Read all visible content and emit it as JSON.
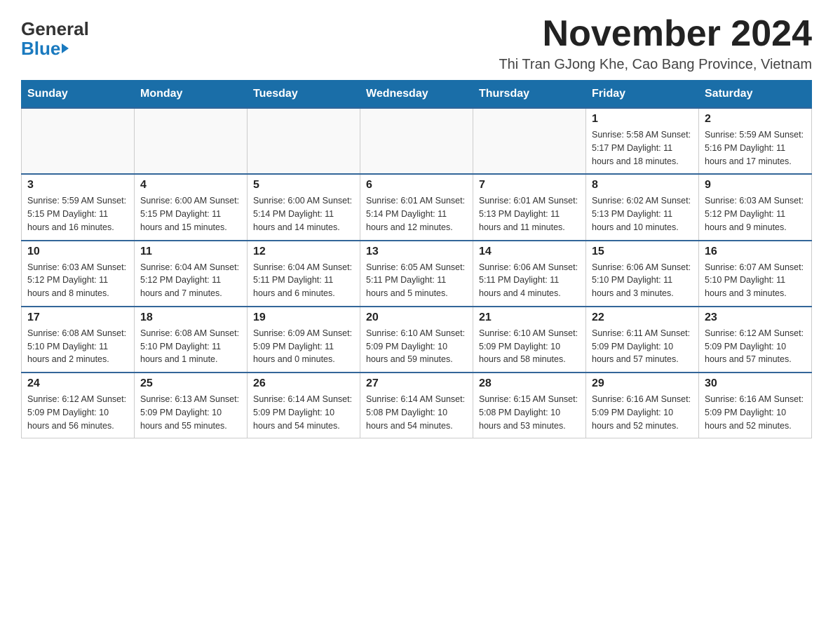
{
  "logo": {
    "general": "General",
    "blue": "Blue"
  },
  "title": "November 2024",
  "location": "Thi Tran GJong Khe, Cao Bang Province, Vietnam",
  "days_of_week": [
    "Sunday",
    "Monday",
    "Tuesday",
    "Wednesday",
    "Thursday",
    "Friday",
    "Saturday"
  ],
  "weeks": [
    [
      {
        "day": "",
        "info": ""
      },
      {
        "day": "",
        "info": ""
      },
      {
        "day": "",
        "info": ""
      },
      {
        "day": "",
        "info": ""
      },
      {
        "day": "",
        "info": ""
      },
      {
        "day": "1",
        "info": "Sunrise: 5:58 AM\nSunset: 5:17 PM\nDaylight: 11 hours and 18 minutes."
      },
      {
        "day": "2",
        "info": "Sunrise: 5:59 AM\nSunset: 5:16 PM\nDaylight: 11 hours and 17 minutes."
      }
    ],
    [
      {
        "day": "3",
        "info": "Sunrise: 5:59 AM\nSunset: 5:15 PM\nDaylight: 11 hours and 16 minutes."
      },
      {
        "day": "4",
        "info": "Sunrise: 6:00 AM\nSunset: 5:15 PM\nDaylight: 11 hours and 15 minutes."
      },
      {
        "day": "5",
        "info": "Sunrise: 6:00 AM\nSunset: 5:14 PM\nDaylight: 11 hours and 14 minutes."
      },
      {
        "day": "6",
        "info": "Sunrise: 6:01 AM\nSunset: 5:14 PM\nDaylight: 11 hours and 12 minutes."
      },
      {
        "day": "7",
        "info": "Sunrise: 6:01 AM\nSunset: 5:13 PM\nDaylight: 11 hours and 11 minutes."
      },
      {
        "day": "8",
        "info": "Sunrise: 6:02 AM\nSunset: 5:13 PM\nDaylight: 11 hours and 10 minutes."
      },
      {
        "day": "9",
        "info": "Sunrise: 6:03 AM\nSunset: 5:12 PM\nDaylight: 11 hours and 9 minutes."
      }
    ],
    [
      {
        "day": "10",
        "info": "Sunrise: 6:03 AM\nSunset: 5:12 PM\nDaylight: 11 hours and 8 minutes."
      },
      {
        "day": "11",
        "info": "Sunrise: 6:04 AM\nSunset: 5:12 PM\nDaylight: 11 hours and 7 minutes."
      },
      {
        "day": "12",
        "info": "Sunrise: 6:04 AM\nSunset: 5:11 PM\nDaylight: 11 hours and 6 minutes."
      },
      {
        "day": "13",
        "info": "Sunrise: 6:05 AM\nSunset: 5:11 PM\nDaylight: 11 hours and 5 minutes."
      },
      {
        "day": "14",
        "info": "Sunrise: 6:06 AM\nSunset: 5:11 PM\nDaylight: 11 hours and 4 minutes."
      },
      {
        "day": "15",
        "info": "Sunrise: 6:06 AM\nSunset: 5:10 PM\nDaylight: 11 hours and 3 minutes."
      },
      {
        "day": "16",
        "info": "Sunrise: 6:07 AM\nSunset: 5:10 PM\nDaylight: 11 hours and 3 minutes."
      }
    ],
    [
      {
        "day": "17",
        "info": "Sunrise: 6:08 AM\nSunset: 5:10 PM\nDaylight: 11 hours and 2 minutes."
      },
      {
        "day": "18",
        "info": "Sunrise: 6:08 AM\nSunset: 5:10 PM\nDaylight: 11 hours and 1 minute."
      },
      {
        "day": "19",
        "info": "Sunrise: 6:09 AM\nSunset: 5:09 PM\nDaylight: 11 hours and 0 minutes."
      },
      {
        "day": "20",
        "info": "Sunrise: 6:10 AM\nSunset: 5:09 PM\nDaylight: 10 hours and 59 minutes."
      },
      {
        "day": "21",
        "info": "Sunrise: 6:10 AM\nSunset: 5:09 PM\nDaylight: 10 hours and 58 minutes."
      },
      {
        "day": "22",
        "info": "Sunrise: 6:11 AM\nSunset: 5:09 PM\nDaylight: 10 hours and 57 minutes."
      },
      {
        "day": "23",
        "info": "Sunrise: 6:12 AM\nSunset: 5:09 PM\nDaylight: 10 hours and 57 minutes."
      }
    ],
    [
      {
        "day": "24",
        "info": "Sunrise: 6:12 AM\nSunset: 5:09 PM\nDaylight: 10 hours and 56 minutes."
      },
      {
        "day": "25",
        "info": "Sunrise: 6:13 AM\nSunset: 5:09 PM\nDaylight: 10 hours and 55 minutes."
      },
      {
        "day": "26",
        "info": "Sunrise: 6:14 AM\nSunset: 5:09 PM\nDaylight: 10 hours and 54 minutes."
      },
      {
        "day": "27",
        "info": "Sunrise: 6:14 AM\nSunset: 5:08 PM\nDaylight: 10 hours and 54 minutes."
      },
      {
        "day": "28",
        "info": "Sunrise: 6:15 AM\nSunset: 5:08 PM\nDaylight: 10 hours and 53 minutes."
      },
      {
        "day": "29",
        "info": "Sunrise: 6:16 AM\nSunset: 5:09 PM\nDaylight: 10 hours and 52 minutes."
      },
      {
        "day": "30",
        "info": "Sunrise: 6:16 AM\nSunset: 5:09 PM\nDaylight: 10 hours and 52 minutes."
      }
    ]
  ]
}
